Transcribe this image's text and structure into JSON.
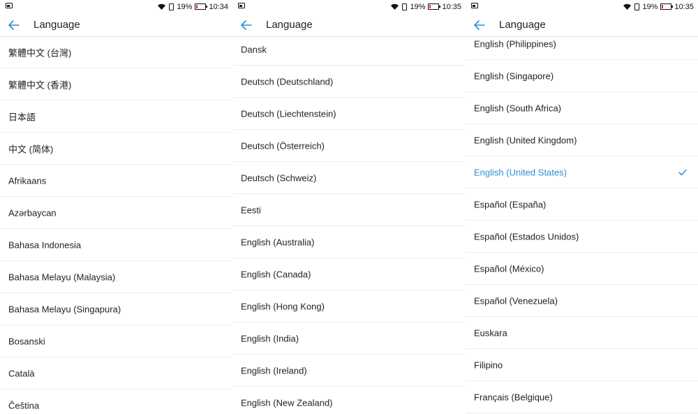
{
  "screens": [
    {
      "status": {
        "battery": "19%",
        "time": "10:34",
        "battery_level": 0.19
      },
      "title": "Language",
      "items": [
        "繁體中文 (台灣)",
        "繁體中文 (香港)",
        "日本語",
        "中文 (简体)",
        "Afrikaans",
        "Azərbaycan",
        "Bahasa Indonesia",
        "Bahasa Melayu (Malaysia)",
        "Bahasa Melayu (Singapura)",
        "Bosanski",
        "Català",
        "Čeština"
      ]
    },
    {
      "status": {
        "battery": "19%",
        "time": "10:35",
        "battery_level": 0.19
      },
      "title": "Language",
      "items": [
        "Dansk",
        "Deutsch (Deutschland)",
        "Deutsch (Liechtenstein)",
        "Deutsch (Österreich)",
        "Deutsch (Schweiz)",
        "Eesti",
        "English (Australia)",
        "English (Canada)",
        "English (Hong Kong)",
        "English (India)",
        "English (Ireland)",
        "English (New Zealand)"
      ]
    },
    {
      "status": {
        "battery": "19%",
        "time": "10:35",
        "battery_level": 0.19
      },
      "title": "Language",
      "selected": "English (United States)",
      "items": [
        "English (Philippines)",
        "English (Singapore)",
        "English (South Africa)",
        "English (United Kingdom)",
        "English (United States)",
        "Español (España)",
        "Español (Estados Unidos)",
        "Español (México)",
        "Español (Venezuela)",
        "Euskara",
        "Filipino",
        "Français (Belgique)"
      ]
    }
  ],
  "icons": {
    "back": "arrow-left-icon",
    "selected": "checkmark-icon",
    "wifi": "wifi-icon",
    "battery": "battery-icon",
    "sim": "sim-icon",
    "notification": "image-notification-icon"
  },
  "colors": {
    "accent": "#2a8fd6",
    "text": "#222222",
    "divider": "#ececec",
    "battery_low": "#e0302a"
  }
}
